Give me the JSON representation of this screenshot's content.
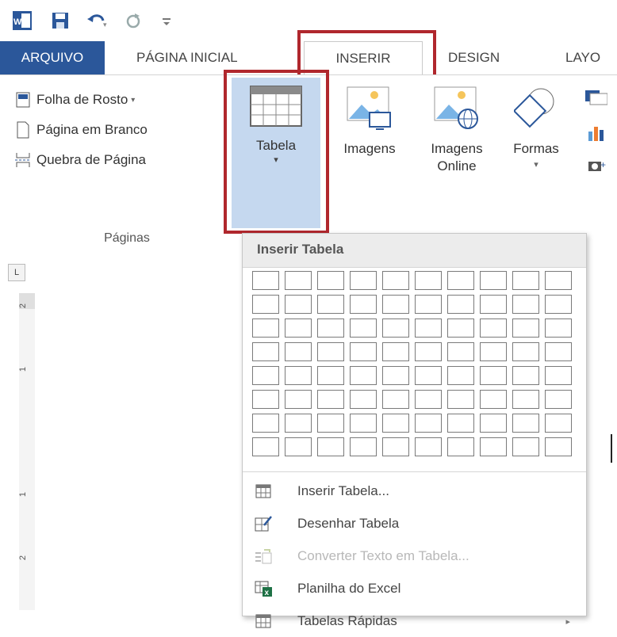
{
  "quick_access": {
    "icons": [
      "word-app-icon",
      "save-icon",
      "undo-icon",
      "redo-icon",
      "customize-qat-icon"
    ]
  },
  "tabs": [
    {
      "label": "ARQUIVO"
    },
    {
      "label": "PÁGINA INICIAL"
    },
    {
      "label": "INSERIR"
    },
    {
      "label": "DESIGN"
    },
    {
      "label": "LAYO"
    }
  ],
  "ribbon": {
    "pages_group": {
      "items": [
        {
          "label": "Folha de Rosto",
          "icon": "cover-page-icon",
          "has_dropdown": true
        },
        {
          "label": "Página em Branco",
          "icon": "blank-page-icon"
        },
        {
          "label": "Quebra de Página",
          "icon": "page-break-icon"
        }
      ],
      "group_label": "Páginas"
    },
    "table_button": {
      "label": "Tabela",
      "caret": "▾"
    },
    "images_button": {
      "label": "Imagens"
    },
    "online_images_button": {
      "label": "Imagens Online"
    },
    "shapes_button": {
      "label": "Formas",
      "caret": "▾"
    }
  },
  "ruler": {
    "numbers": [
      "2",
      "1",
      "1",
      "2"
    ],
    "corner": "L"
  },
  "dropdown": {
    "title": "Inserir Tabela",
    "grid": {
      "cols": 10,
      "rows": 8
    },
    "items": [
      {
        "label": "Inserir Tabela...",
        "icon": "insert-table-icon",
        "disabled": false
      },
      {
        "label": "Desenhar Tabela",
        "icon": "draw-table-icon",
        "disabled": false
      },
      {
        "label": "Converter Texto em Tabela...",
        "icon": "convert-text-icon",
        "disabled": true
      },
      {
        "label": "Planilha do Excel",
        "icon": "excel-sheet-icon",
        "disabled": false
      },
      {
        "label": "Tabelas Rápidas",
        "icon": "quick-tables-icon",
        "disabled": false,
        "submenu": "▸"
      }
    ]
  },
  "colors": {
    "accent": "#2b579a",
    "highlight": "#b0272d",
    "excel": "#1e7145"
  }
}
